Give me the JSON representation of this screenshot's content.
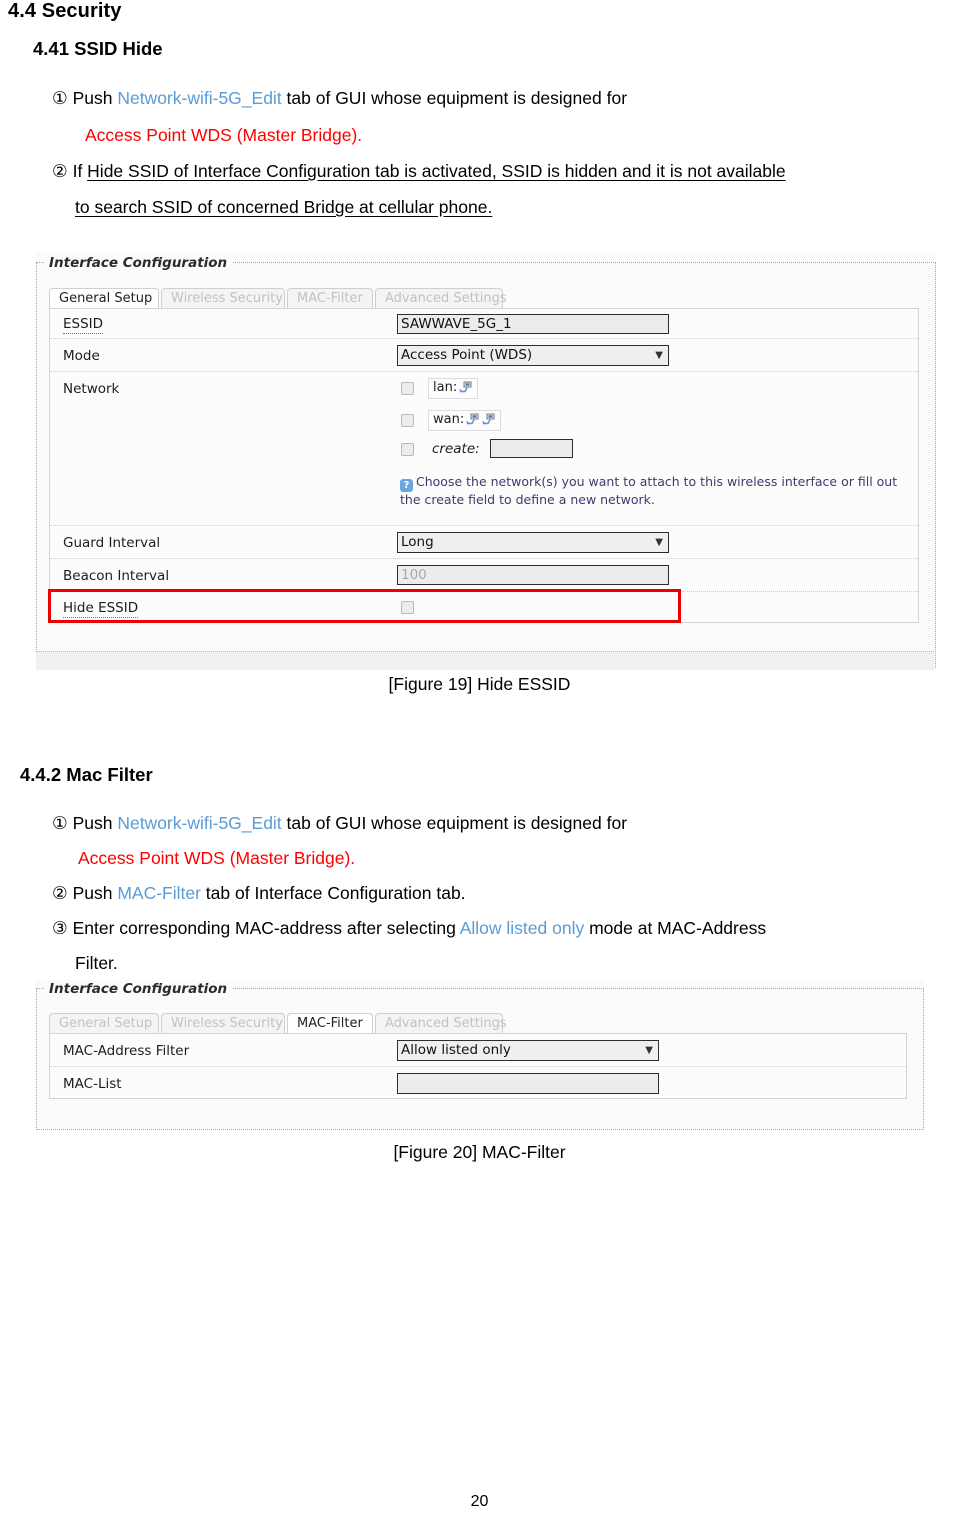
{
  "document": {
    "section_title": "4.4 Security",
    "page_number": "20"
  },
  "section_ssid_hide": {
    "heading": "4.41 SSID Hide",
    "steps": [
      {
        "marker": "①",
        "line1_pre": "Push ",
        "line1_link": "Network-wifi-5G_Edit",
        "line1_post": " tab of GUI whose equipment is designed for",
        "line2_red": "Access Point WDS (Master Bridge)."
      },
      {
        "marker": "②",
        "line1_pre": "If ",
        "line1_underline": "Hide SSID of Interface Configuration tab is activated, SSID is hidden and it is not available",
        "line2_underline": "to search SSID of concerned Bridge at cellular phone."
      }
    ],
    "caption": "[Figure 19] Hide ESSID"
  },
  "section_mac_filter": {
    "heading": "4.4.2 Mac Filter",
    "steps": [
      {
        "marker": "①",
        "pre": "Push ",
        "link": "Network-wifi-5G_Edit",
        "post": " tab of GUI whose equipment is designed for",
        "line2_red": "Access Point WDS (Master Bridge)."
      },
      {
        "marker": "②",
        "pre": "Push ",
        "link": "MAC-Filter",
        "post": " tab of Interface Configuration tab."
      },
      {
        "marker": "③",
        "pre": "Enter corresponding MAC-address after selecting ",
        "link": "Allow listed only",
        "post": " mode at MAC-Address",
        "line2": "Filter."
      }
    ],
    "caption": "[Figure 20] MAC-Filter"
  },
  "figure19": {
    "legend": "Interface Configuration",
    "tabs": [
      {
        "label": "General Setup",
        "active": true
      },
      {
        "label": "Wireless Security",
        "active": false
      },
      {
        "label": "MAC-Filter",
        "active": false
      },
      {
        "label": "Advanced Settings",
        "active": false
      }
    ],
    "rows": {
      "essid": {
        "label": "ESSID",
        "value": "SAWWAVE_5G_1"
      },
      "mode": {
        "label": "Mode",
        "value": "Access Point (WDS)"
      },
      "network": {
        "label": "Network",
        "options": [
          {
            "label": "lan:",
            "icons": 1,
            "checked": false
          },
          {
            "label": "wan:",
            "icons": 2,
            "checked": false
          }
        ],
        "create_label": "create:",
        "create_value": "",
        "create_checked": false,
        "hint": "Choose the network(s) you want to attach to this wireless interface or fill out the create field to define a new network."
      },
      "guard_interval": {
        "label": "Guard Interval",
        "value": "Long"
      },
      "beacon_interval": {
        "label": "Beacon Interval",
        "value": "100"
      },
      "hide_essid": {
        "label": "Hide ESSID",
        "checked": false
      }
    },
    "highlight_color": "#ee0000"
  },
  "figure20": {
    "legend": "Interface Configuration",
    "tabs": [
      {
        "label": "General Setup",
        "active": false
      },
      {
        "label": "Wireless Security",
        "active": false
      },
      {
        "label": "MAC-Filter",
        "active": true
      },
      {
        "label": "Advanced Settings",
        "active": false
      }
    ],
    "rows": {
      "mac_address_filter": {
        "label": "MAC-Address Filter",
        "value": "Allow listed only"
      },
      "mac_list": {
        "label": "MAC-List",
        "value": ""
      }
    }
  },
  "icons": {
    "dropdown_arrow": "▼",
    "help": "?"
  }
}
